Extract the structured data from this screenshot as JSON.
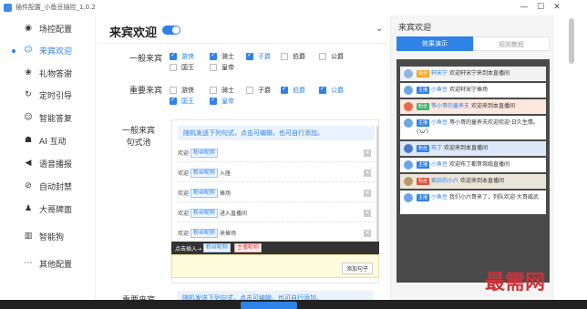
{
  "window": {
    "title": "插件配置_小鱼豆插控_1.0.2",
    "minimize": "—",
    "maximize": "☐",
    "close": "✕"
  },
  "sidebar": {
    "items": [
      {
        "icon": "◉",
        "label": "场控配置"
      },
      {
        "icon": "☺",
        "label": "来宾欢迎"
      },
      {
        "icon": "❀",
        "label": "礼物答谢"
      },
      {
        "icon": "↻",
        "label": "定时引导"
      },
      {
        "icon": "☺",
        "label": "智能答复"
      },
      {
        "icon": "☗",
        "label": "AI 互动"
      },
      {
        "icon": "◀",
        "label": "语音播报"
      },
      {
        "icon": "⊘",
        "label": "自动封禁"
      },
      {
        "icon": "♟",
        "label": "大哥牌面"
      },
      {
        "icon": "▥",
        "label": "智能狗"
      },
      {
        "icon": "⋯",
        "label": "其他配置"
      }
    ],
    "active_index": 1
  },
  "main": {
    "title": "来宾欢迎",
    "toggle_on": true,
    "general_guest": {
      "label": "一般来宾",
      "options": [
        {
          "text": "游侠",
          "checked": true
        },
        {
          "text": "骑士",
          "checked": true
        },
        {
          "text": "子爵",
          "checked": true
        },
        {
          "text": "伯爵",
          "checked": false
        },
        {
          "text": "公爵",
          "checked": false
        },
        {
          "text": "国王",
          "checked": false
        },
        {
          "text": "皇帝",
          "checked": false
        }
      ]
    },
    "vip_guest": {
      "label": "重要来宾",
      "options": [
        {
          "text": "游侠",
          "checked": false
        },
        {
          "text": "骑士",
          "checked": false
        },
        {
          "text": "子爵",
          "checked": false
        },
        {
          "text": "伯爵",
          "checked": true
        },
        {
          "text": "公爵",
          "checked": true
        },
        {
          "text": "国王",
          "checked": true
        },
        {
          "text": "皇帝",
          "checked": true
        }
      ]
    },
    "sentence_pool": {
      "label_line1": "一般来宾",
      "label_line2": "句式池",
      "hint": "随机发送下列句式，点击可编辑，也可自行添加。",
      "rows": [
        {
          "prefix": "欢迎",
          "tag": "粉丝昵称",
          "suffix": ""
        },
        {
          "prefix": "欢迎",
          "tag": "粉丝昵称",
          "suffix": "入座"
        },
        {
          "prefix": "欢迎",
          "tag": "粉丝昵称",
          "suffix": "捧场"
        },
        {
          "prefix": "欢迎",
          "tag": "粉丝昵称",
          "suffix": "进入直播间"
        },
        {
          "prefix": "欢迎",
          "tag": "粉丝昵称",
          "suffix": "来捧场"
        }
      ],
      "insert_label": "点击插入→",
      "insert_tag1": "粉丝昵称",
      "insert_tag2": "主播昵称",
      "add_button": "添加句子"
    },
    "vip_pool": {
      "label": "重要来宾",
      "hint": "随机发送下列句式，点击可编辑，也可自行添加。"
    }
  },
  "preview": {
    "title": "来宾欢迎",
    "tabs": [
      "效果演示",
      "规则教程"
    ],
    "messages": [
      {
        "avatar": "#8fb4e6",
        "badge": "粉丝",
        "badge_color": "#f5a623",
        "nick": "轩宋宁",
        "text": "欢迎轩宋宁来到本直播间",
        "bg": "#f2f2f2"
      },
      {
        "avatar": "#6aa6e8",
        "badge": "主播",
        "badge_color": "#2f82e6",
        "nick": "小鱼豆",
        "text": "欢迎轩宋宁捧场",
        "bg": "#ffffff"
      },
      {
        "avatar": "#e46b4b",
        "badge": "粉丝",
        "badge_color": "#3cb371",
        "nick": "等小哥的童养夫",
        "text": "欢迎来到本直播间",
        "bg": "#fde7df"
      },
      {
        "avatar": "#6aa6e8",
        "badge": "主播",
        "badge_color": "#2f82e6",
        "nick": "小鱼豆",
        "text": "等小哥的童养夫欢迎欢迎·日久生情。('ω')",
        "bg": "#ffffff"
      },
      {
        "avatar": "#4c79c9",
        "badge": "粉丝",
        "badge_color": "#2f82e6",
        "nick": "布丁",
        "text": "欢迎来到本直播间",
        "bg": "#dde8f8"
      },
      {
        "avatar": "#6aa6e8",
        "badge": "主播",
        "badge_color": "#2f82e6",
        "nick": "小鱼豆",
        "text": "欢迎布丁都哥驾临直播间",
        "bg": "#ffffff"
      },
      {
        "avatar": "#b89a68",
        "badge": "粉丝",
        "badge_color": "#e0523a",
        "nick": "疯狂的小六",
        "text": "欢迎来到本直播间",
        "bg": "#ece6da"
      },
      {
        "avatar": "#6aa6e8",
        "badge": "主播",
        "badge_color": "#2f82e6",
        "nick": "小鱼豆",
        "text": "我们小六哥来了，列队欢迎·大哥威武",
        "bg": "#ffffff"
      }
    ]
  },
  "watermark": "最需网"
}
